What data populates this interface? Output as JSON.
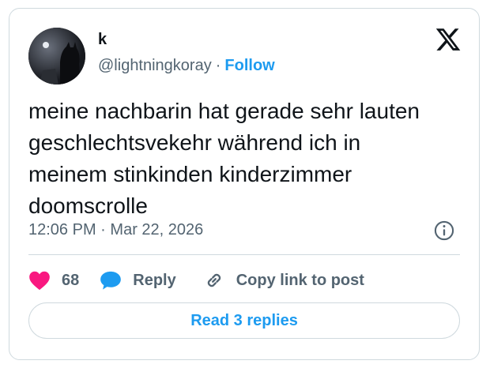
{
  "author": {
    "display_name": "k",
    "handle": "@lightningkoray",
    "separator": "·",
    "follow_label": "Follow"
  },
  "brand": {
    "logo_icon": "x-logo-icon"
  },
  "tweet": {
    "text_lines": [
      "meine nachbarin hat gerade sehr lauten",
      "geschlechtsvekehr während ich in",
      "meinem stinkinden kinderzimmer",
      "doomscrolle"
    ],
    "time": "12:06 PM",
    "separator": "·",
    "date": "Mar 22, 2026",
    "info_icon": "info-icon"
  },
  "actions": {
    "like_count": "68",
    "like_icon": "heart-icon",
    "like_color": "#f91880",
    "reply_label": "Reply",
    "reply_icon": "reply-bubble-icon",
    "reply_color": "#1d9bf0",
    "copy_label": "Copy link to post",
    "copy_icon": "link-icon"
  },
  "replies_button": {
    "label": "Read 3 replies"
  },
  "colors": {
    "accent": "#1d9bf0",
    "text": "#0f1419",
    "muted": "#536471",
    "border": "#cfd9de"
  }
}
